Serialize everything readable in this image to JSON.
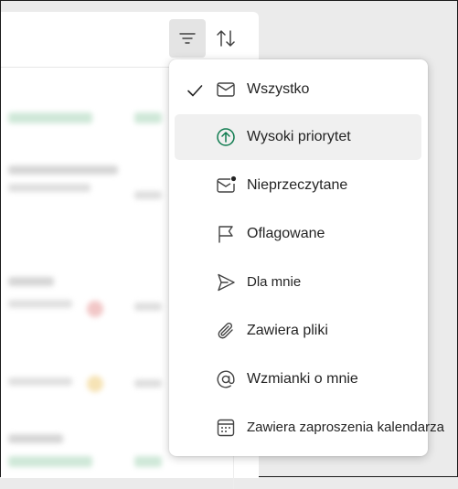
{
  "toolbar": {
    "filter_icon": "filter-lines-icon",
    "sort_icon": "sort-arrows-icon"
  },
  "filter_menu": {
    "items": [
      {
        "label": "Wszystko",
        "icon": "mail-icon",
        "checked": true
      },
      {
        "label": "Wysoki priorytet",
        "icon": "arrow-up-circle-icon",
        "hovered": true
      },
      {
        "label": "Nieprzeczytane",
        "icon": "mail-unread-icon"
      },
      {
        "label": "Oflagowane",
        "icon": "flag-icon"
      },
      {
        "label": "Dla mnie",
        "icon": "send-icon"
      },
      {
        "label": "Zawiera pliki",
        "icon": "attach-icon"
      },
      {
        "label": "Wzmianki o mnie",
        "icon": "mention-icon"
      },
      {
        "label": "Zawiera zaproszenia kalendarza",
        "icon": "calendar-icon"
      }
    ]
  },
  "colors": {
    "accent_green": "#0f7b4f",
    "text": "#242424",
    "hover_bg": "#f0f0f0"
  }
}
